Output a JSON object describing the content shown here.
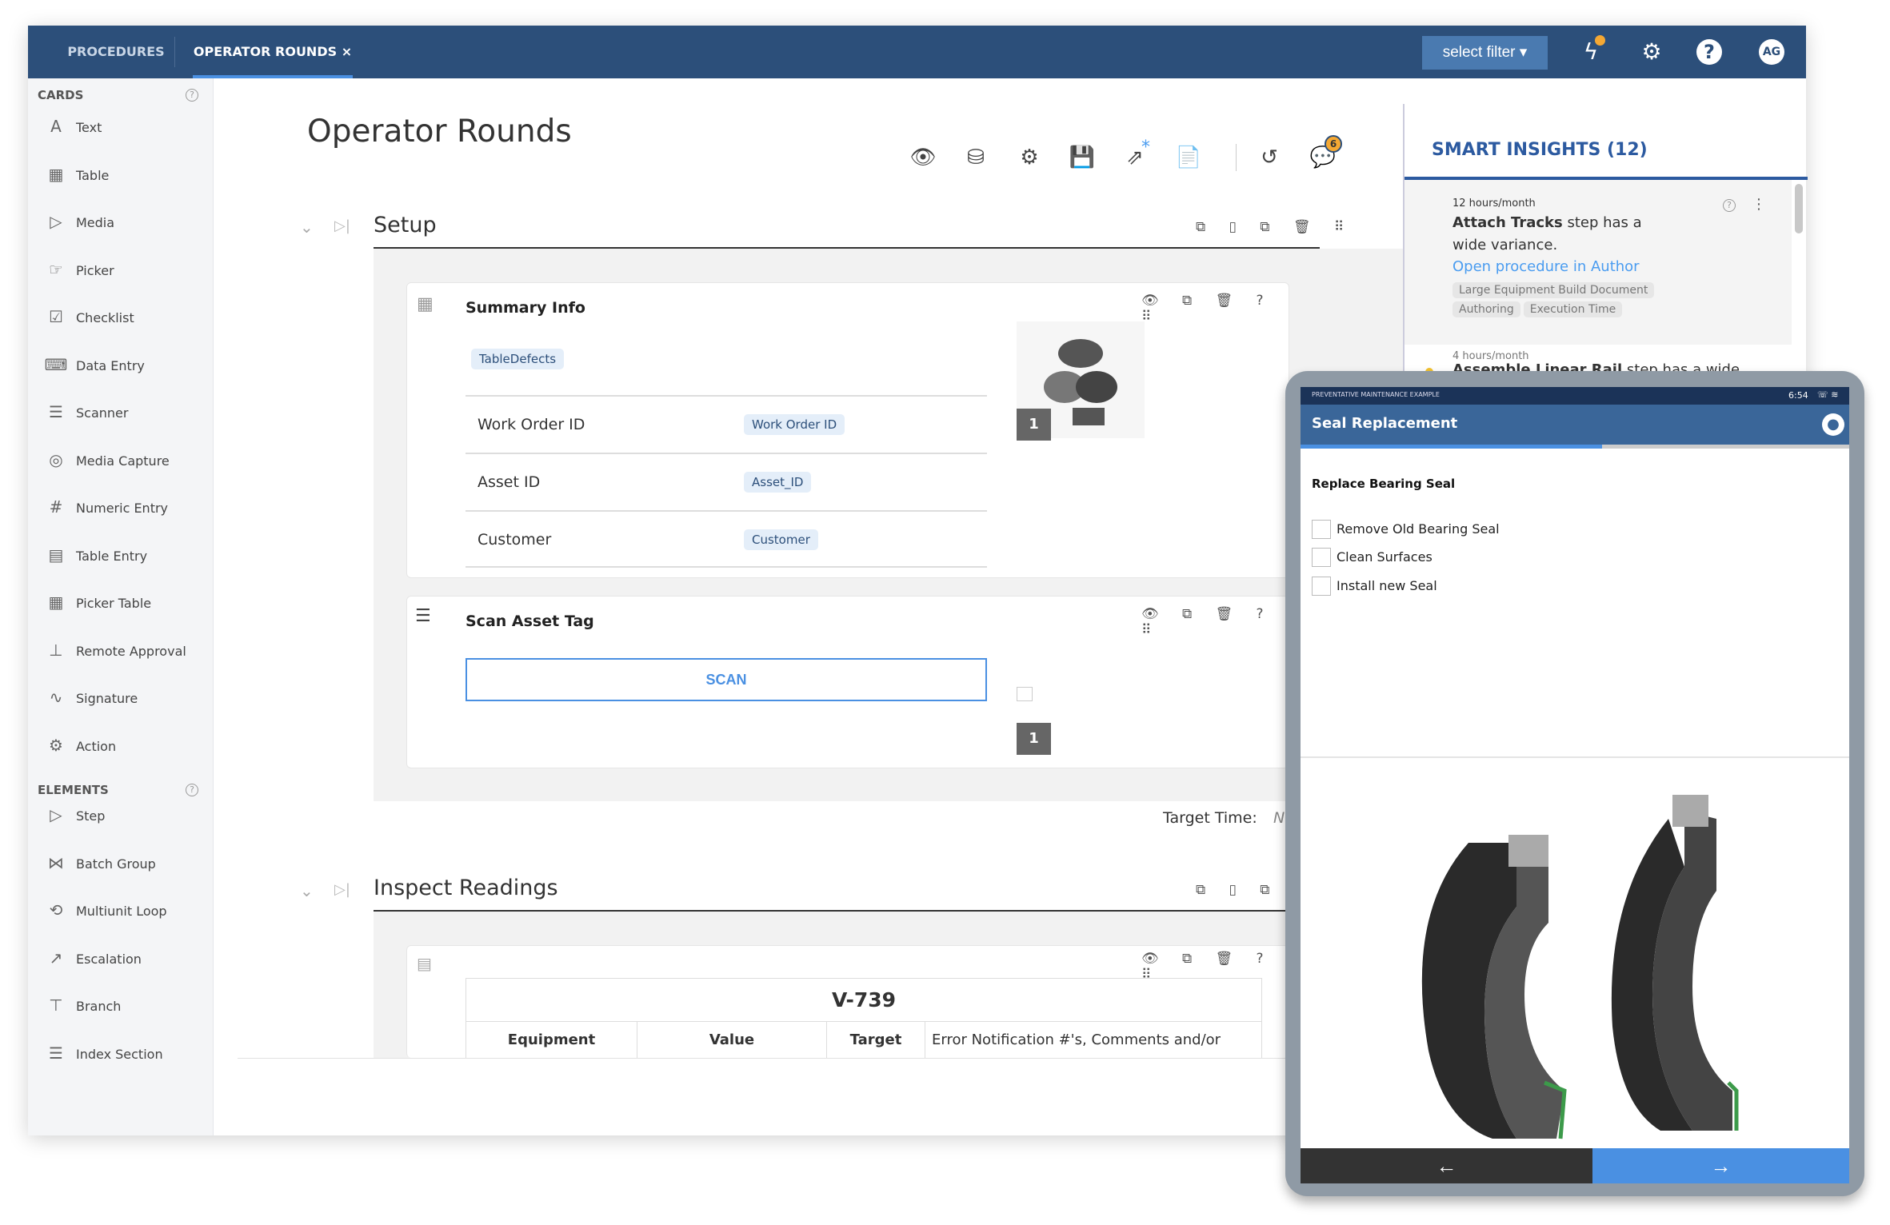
{
  "topbar": {
    "tabs": [
      {
        "label": "PROCEDURES"
      },
      {
        "label": "OPERATOR ROUNDS ×"
      }
    ],
    "filter": "select filter ▾",
    "avatar": "AG",
    "accent": "#2c4f7a",
    "notif_dot": "#f5a833"
  },
  "sidebar": {
    "cards_label": "CARDS",
    "cards": [
      {
        "label": "Text",
        "icon": "text-icon",
        "glyph": "A"
      },
      {
        "label": "Table",
        "icon": "table-icon",
        "glyph": "▦"
      },
      {
        "label": "Media",
        "icon": "play-icon",
        "glyph": "▷"
      },
      {
        "label": "Picker",
        "icon": "picker-icon",
        "glyph": "☞"
      },
      {
        "label": "Checklist",
        "icon": "checkbox-icon",
        "glyph": "☑"
      },
      {
        "label": "Data Entry",
        "icon": "data-entry-icon",
        "glyph": "⌨"
      },
      {
        "label": "Scanner",
        "icon": "scanner-icon",
        "glyph": "☰"
      },
      {
        "label": "Media Capture",
        "icon": "camera-icon",
        "glyph": "◎"
      },
      {
        "label": "Numeric Entry",
        "icon": "numeric-icon",
        "glyph": "#"
      },
      {
        "label": "Table Entry",
        "icon": "table-entry-icon",
        "glyph": "▤"
      },
      {
        "label": "Picker Table",
        "icon": "picker-table-icon",
        "glyph": "▦"
      },
      {
        "label": "Remote Approval",
        "icon": "stamp-icon",
        "glyph": "⊥"
      },
      {
        "label": "Signature",
        "icon": "signature-icon",
        "glyph": "∿"
      },
      {
        "label": "Action",
        "icon": "action-icon",
        "glyph": "⚙"
      }
    ],
    "elements_label": "ELEMENTS",
    "elements": [
      {
        "label": "Step",
        "icon": "step-icon",
        "glyph": "▷"
      },
      {
        "label": "Batch Group",
        "icon": "batch-icon",
        "glyph": "⋈"
      },
      {
        "label": "Multiunit Loop",
        "icon": "loop-icon",
        "glyph": "⟲"
      },
      {
        "label": "Escalation",
        "icon": "escalation-icon",
        "glyph": "↗"
      },
      {
        "label": "Branch",
        "icon": "branch-icon",
        "glyph": "⊤"
      },
      {
        "label": "Index Section",
        "icon": "list-icon",
        "glyph": "☰"
      }
    ]
  },
  "main": {
    "title": "Operator Rounds",
    "comment_count": "6",
    "setup": {
      "title": "Setup",
      "summary": {
        "title": "Summary Info",
        "chip": "TableDefects",
        "rows": [
          {
            "label": "Work Order ID",
            "value": "Work Order ID"
          },
          {
            "label": "Asset ID",
            "value": "Asset_ID"
          },
          {
            "label": "Customer",
            "value": "Customer"
          }
        ],
        "badge": "1"
      },
      "scan": {
        "title": "Scan Asset Tag",
        "button": "SCAN",
        "badge": "1"
      },
      "target_label": "Target Time:",
      "target_value": "N"
    },
    "inspect": {
      "title": "Inspect Readings",
      "table_title": "V-739",
      "columns": [
        "Equipment",
        "Value",
        "Target",
        "Error Notification #'s, Comments and/or"
      ]
    }
  },
  "insights": {
    "title": "SMART INSIGHTS (12)",
    "items": [
      {
        "meta": "12 hours/month",
        "bold": "Attach Tracks",
        "text": " step has a wide variance.",
        "link": "Open procedure in Author",
        "tags": [
          "Large Equipment Build Document",
          "Authoring",
          "Execution Time"
        ]
      },
      {
        "meta": "4 hours/month",
        "bold": "Assemble Linear Rail",
        "text": " step has a wide"
      }
    ]
  },
  "tablet": {
    "status_title": "PREVENTATIVE MAINTENANCE EXAMPLE",
    "time": "6:54",
    "header": "Seal Replacement",
    "progress": 0.55,
    "step_title": "Replace Bearing Seal",
    "checklist": [
      {
        "label": "Remove Old Bearing Seal",
        "checked": false
      },
      {
        "label": "Clean Surfaces",
        "checked": false
      },
      {
        "label": "Install new Seal",
        "checked": false
      }
    ],
    "prev": "←",
    "next": "→"
  }
}
